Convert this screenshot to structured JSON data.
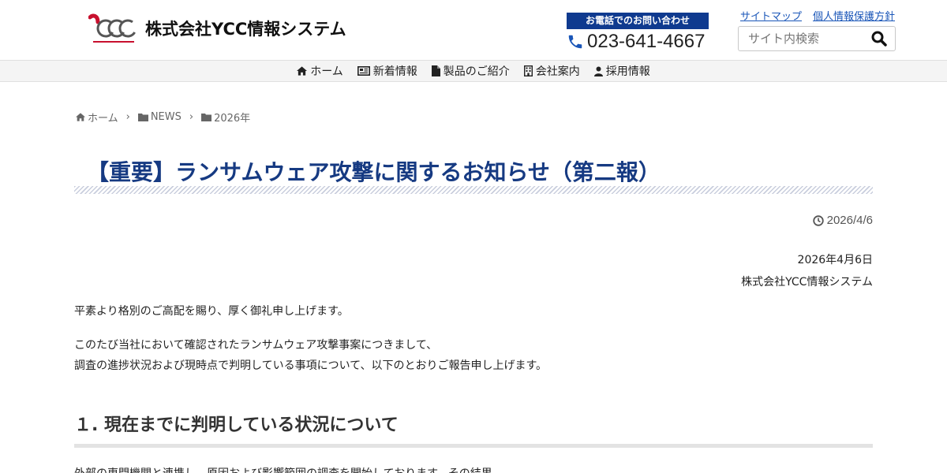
{
  "header": {
    "company_name": "株式会社YCC情報システム",
    "contact_label": "お電話でのお問い合わせ",
    "phone": "023-641-4667",
    "links": [
      "サイトマップ",
      "個人情報保護方針"
    ],
    "search_placeholder": "サイト内検索"
  },
  "nav": {
    "items": [
      "ホーム",
      "新着情報",
      "製品のご紹介",
      "会社案内",
      "採用情報"
    ]
  },
  "breadcrumb": [
    "ホーム",
    "NEWS",
    "2026年"
  ],
  "article": {
    "title": "【重要】ランサムウェア攻撃に関するお知らせ（第二報）",
    "published": "2026/4/6",
    "sign_date": "2026年4月6日",
    "sign_company": "株式会社YCC情報システム",
    "para1": "平素より格別のご高配を賜り、厚く御礼申し上げます。",
    "para2_line1": "このたび当社において確認されたランサムウェア攻撃事案につきまして、",
    "para2_line2": "調査の進捗状況および現時点で判明している事項について、以下のとおりご報告申し上げます。",
    "section1": "１. 現在までに判明している状況について",
    "para3": "外部の専門機関と連携し、原因および影響範囲の調査を開始しております。その結果、"
  },
  "colors": {
    "brand_blue": "#0f3a8f",
    "title_blue": "#163a82",
    "logo_red": "#c8102e",
    "link_blue": "#1a56b8"
  }
}
